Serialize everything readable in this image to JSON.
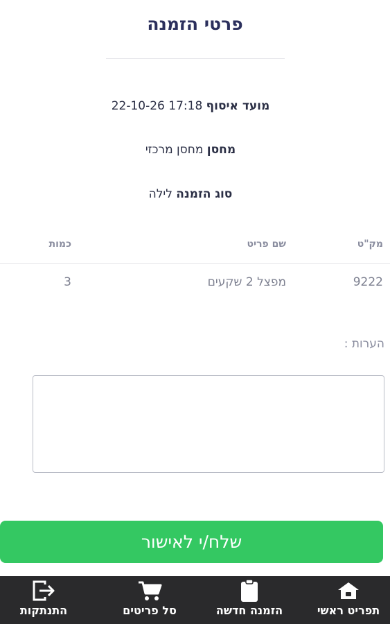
{
  "page_title": "פרטי הזמנה",
  "order": {
    "pickup_label": "מועד איסוף",
    "pickup_value": "22-10-26 17:18",
    "warehouse_label": "מחסן",
    "warehouse_value": "מחסן מרכזי",
    "type_label": "סוג הזמנה",
    "type_value": "לילה"
  },
  "table": {
    "headers": {
      "sku": "מק\"ט",
      "name": "שם פריט",
      "qty": "כמות"
    },
    "rows": [
      {
        "sku": "9222",
        "name": "מפצל 2 שקעים",
        "qty": "3"
      }
    ]
  },
  "notes": {
    "label": "הערות :",
    "value": ""
  },
  "send_button": "שלח/י לאישור",
  "bottom_nav": {
    "home": "תפריט ראשי",
    "new_order": "הזמנה חדשה",
    "cart": "סל פריטים",
    "logout": "התנתקות"
  },
  "colors": {
    "accent_green": "#34c862",
    "nav_bg": "#2a2a2c",
    "title": "#2b2f5c"
  },
  "icons": {
    "home": "home-icon",
    "new_order": "clipboard-icon",
    "cart": "cart-icon",
    "logout": "logout-icon"
  }
}
